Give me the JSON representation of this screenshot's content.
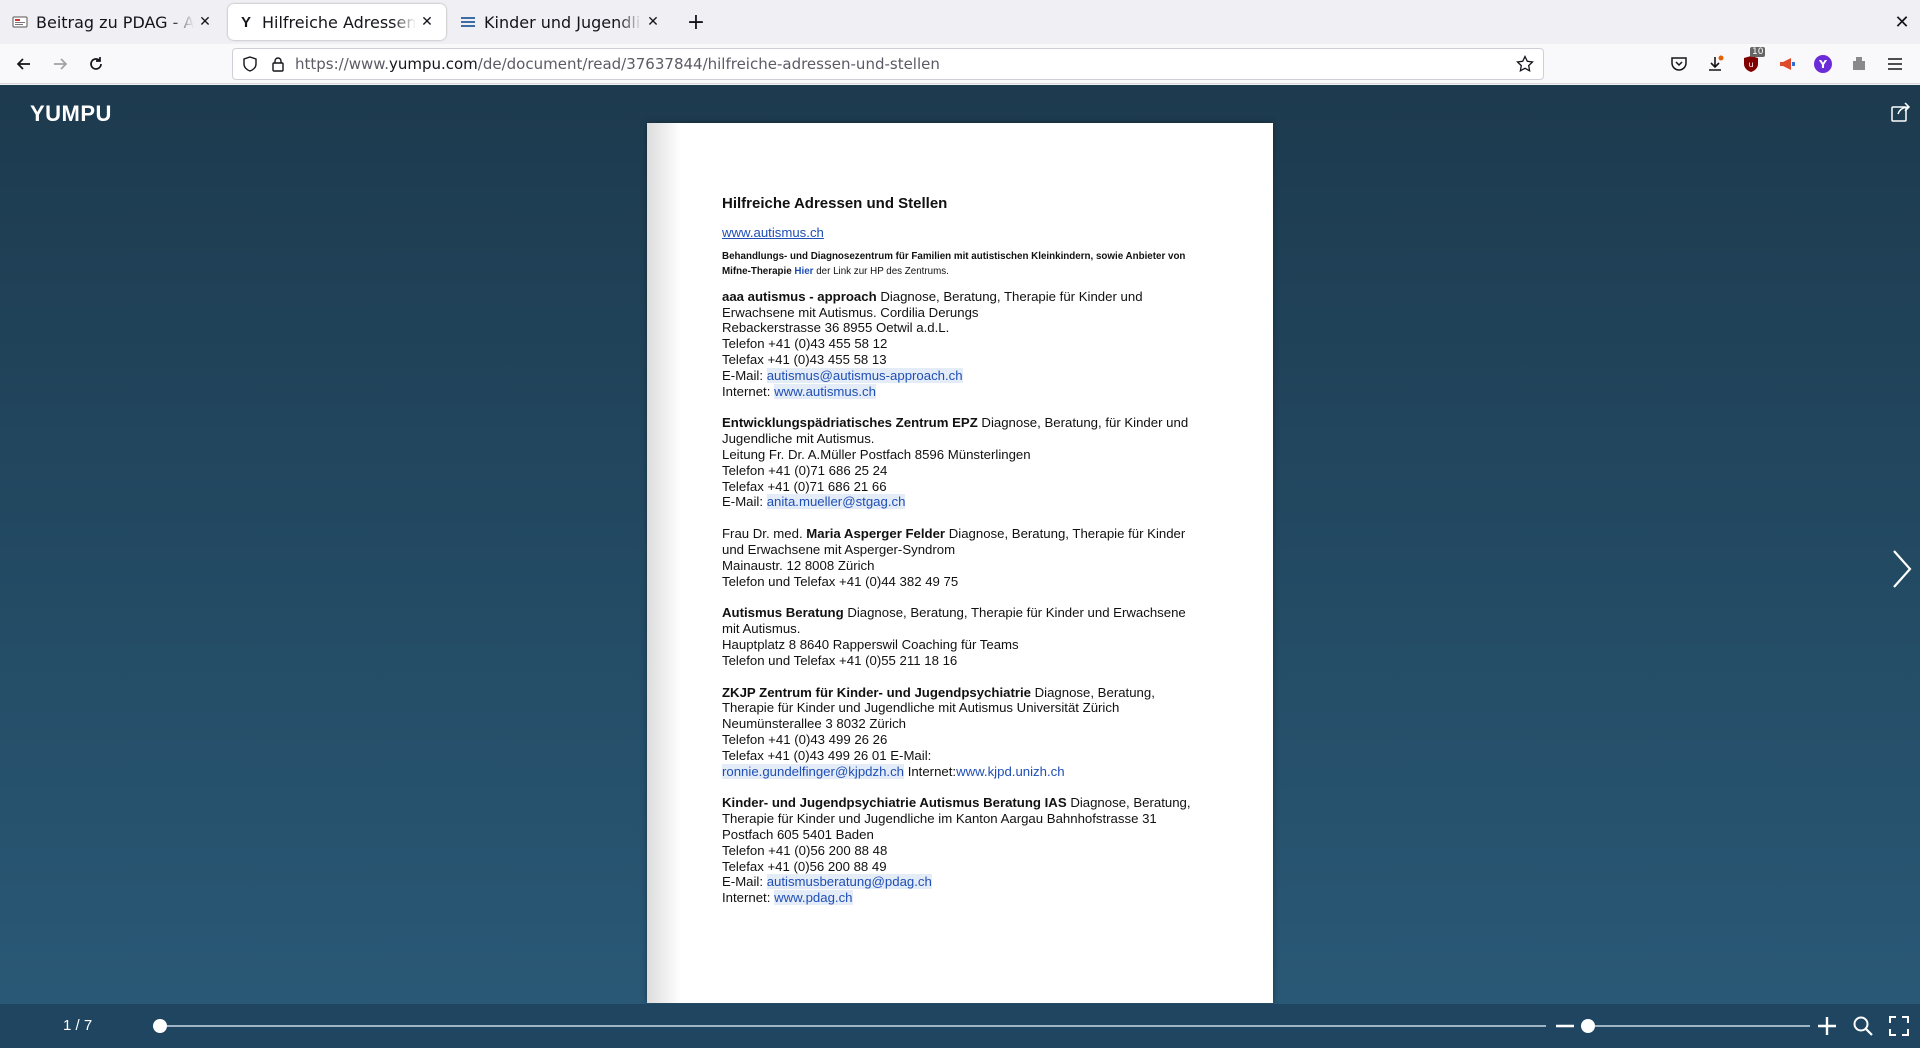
{
  "tabs": [
    {
      "title": "Beitrag zu PDAG - Autismus",
      "favicon": "document-icon"
    },
    {
      "title": "Hilfreiche Adressen und Stellen",
      "favicon": "yumpu-y-icon"
    },
    {
      "title": "Kinder und Jugendliche - Psychiatrie",
      "favicon": "flag-icon"
    }
  ],
  "url": {
    "prefix": "https://www.",
    "host": "yumpu.com",
    "path": "/de/document/read/37637844/hilfreiche-adressen-und-stellen"
  },
  "toolbar": {
    "badge_count": "10"
  },
  "viewer": {
    "logo": "YUMPU",
    "page_indicator": "1 / 7",
    "progress": 0.0
  },
  "document": {
    "title": "Hilfreiche Adressen und Stellen",
    "top_link": "www.autismus.ch",
    "intro_bold": "Behandlungs- und Diagnosezentrum für Familien mit autistischen Kleinkindern, sowie Anbieter von Mifne-Therapie",
    "intro_link": "Hier",
    "intro_rest": "der Link zur HP des Zentrums.",
    "entries": {
      "aaa": {
        "name": " aaa autismus - approach",
        "desc": "Diagnose, Beratung, Therapie für Kinder und Erwachsene mit Autismus. Cordilia Derungs",
        "address": "Rebackerstrasse 36 8955 Oetwil a.d.L.",
        "phone": "Telefon +41 (0)43 455 58 12",
        "fax": "Telefax +41 (0)43 455 58 13",
        "email_label": "E-Mail:",
        "email": "autismus@autismus-approach.ch",
        "web_label": "Internet:",
        "web": "www.autismus.ch"
      },
      "epz": {
        "name": "Entwicklungspädriatisches Zentrum EPZ",
        "desc": "Diagnose, Beratung, für Kinder und Jugendliche mit Autismus.",
        "address": "Leitung Fr. Dr. A.Müller Postfach 8596 Münsterlingen",
        "phone": "Telefon +41 (0)71 686 25 24",
        "fax": "Telefax +41 (0)71 686 21 66",
        "email_label": "E-Mail:",
        "email": "anita.mueller@stgag.ch"
      },
      "asperger": {
        "prefix": "Frau Dr. med.",
        "name": "Maria Asperger Felder",
        "desc": "Diagnose, Beratung, Therapie für Kinder und Erwachsene mit Asperger-Syndrom",
        "address": "Mainaustr. 12 8008 Zürich",
        "phone": "Telefon und Telefax +41 (0)44 382 49 75"
      },
      "beratung": {
        "name": "Autismus Beratung",
        "desc": "Diagnose, Beratung, Therapie für Kinder und Erwachsene mit Autismus.",
        "address": "Hauptplatz 8 8640 Rapperswil Coaching für Teams",
        "phone": "Telefon und Telefax +41 (0)55 211 18 16"
      },
      "zkjp": {
        "name": "ZKJP Zentrum für Kinder- und Jugendpsychiatrie",
        "desc": "Diagnose, Beratung, Therapie für Kinder und Jugendliche mit Autismus Universität Zürich Neumünsterallee 3 8032 Zürich",
        "phone": "Telefon +41 (0)43 499 26 26",
        "fax": "Telefax +41 (0)43 499 26 01 E-Mail:",
        "email": "ronnie.gundelfinger@kjpdzh.ch",
        "web_label": "Internet:",
        "web": "www.kjpd.unizh.ch"
      },
      "ias": {
        "name": "Kinder- und Jugendpsychiatrie Autismus Beratung IAS",
        "desc": "Diagnose, Beratung, Therapie für Kinder und Jugendliche im Kanton Aargau Bahnhofstrasse 31 Postfach 605 5401 Baden",
        "phone": "Telefon +41 (0)56 200 88 48",
        "fax": "Telefax +41 (0)56 200 88 49",
        "email_label": "E-Mail:",
        "email": "autismusberatung@pdag.ch",
        "web_label": "Internet:",
        "web": "www.pdag.ch"
      }
    }
  }
}
